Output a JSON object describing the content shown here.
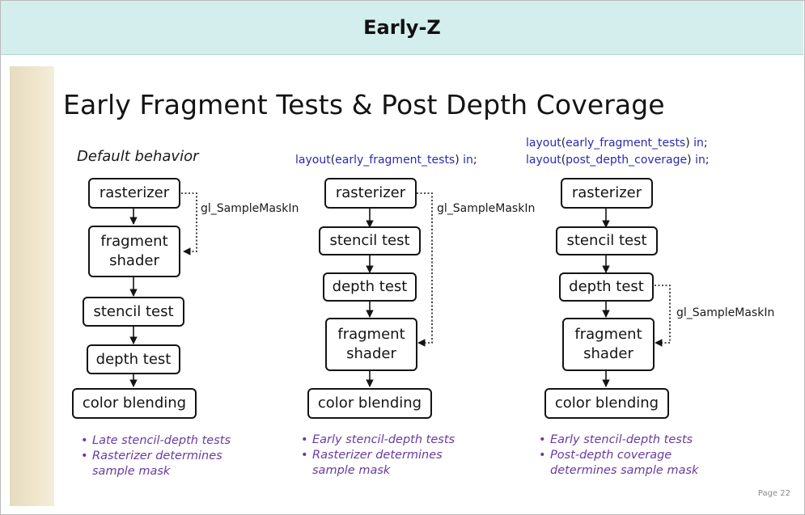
{
  "header": {
    "title": "Early-Z"
  },
  "slide": {
    "title": "Early Fragment Tests & Post Depth Coverage",
    "page": "Page 22",
    "columns": [
      {
        "heading": "Default behavior",
        "code": [],
        "boxes": {
          "rasterizer": "rasterizer",
          "fragment_1": "fragment",
          "fragment_2": "shader",
          "stencil": "stencil test",
          "depth": "depth test",
          "blend": "color blending"
        },
        "annotation": "gl_SampleMaskIn",
        "notes": [
          "Late stencil-depth tests",
          "Rasterizer determines",
          "sample mask"
        ]
      },
      {
        "heading": "",
        "code": [
          {
            "kw": "layout",
            "p1": "(",
            "arg": "early_fragment_tests",
            "p2": ")",
            "in": "in",
            "semi": ";"
          }
        ],
        "boxes": {
          "rasterizer": "rasterizer",
          "stencil": "stencil test",
          "depth": "depth test",
          "fragment_1": "fragment",
          "fragment_2": "shader",
          "blend": "color blending"
        },
        "annotation": "gl_SampleMaskIn",
        "notes": [
          "Early stencil-depth tests",
          "Rasterizer determines",
          "sample mask"
        ]
      },
      {
        "heading": "",
        "code": [
          {
            "kw": "layout",
            "p1": "(",
            "arg": "early_fragment_tests",
            "p2": ")",
            "in": "in",
            "semi": ";"
          },
          {
            "kw": "layout",
            "p1": "(",
            "arg": "post_depth_coverage",
            "p2": ")",
            "in": "in",
            "semi": ";"
          }
        ],
        "boxes": {
          "rasterizer": "rasterizer",
          "stencil": "stencil test",
          "depth": "depth test",
          "fragment_1": "fragment",
          "fragment_2": "shader",
          "blend": "color blending"
        },
        "annotation": "gl_SampleMaskIn",
        "notes": [
          "Early stencil-depth tests",
          "Post-depth coverage",
          "determines sample mask"
        ]
      }
    ]
  }
}
